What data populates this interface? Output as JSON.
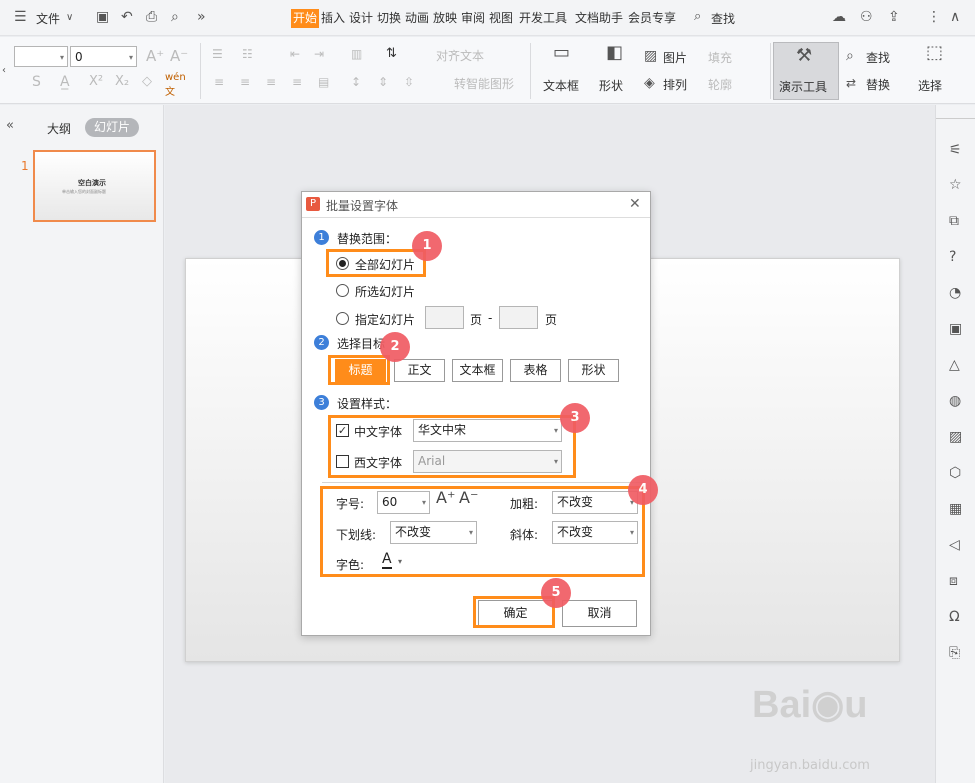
{
  "menubar": {
    "file_label": "文件",
    "tabs": [
      "开始",
      "插入",
      "设计",
      "切换",
      "动画",
      "放映",
      "审阅",
      "视图",
      "开发工具",
      "文档助手",
      "会员专享"
    ],
    "search_label": "查找"
  },
  "ribbon": {
    "font_size_value": "0",
    "align_text": "对齐文本",
    "smart_shape": "转智能图形",
    "textbox_label": "文本框",
    "shape_label": "形状",
    "picture_label": "图片",
    "arrange_label": "排列",
    "fill_label": "填充",
    "outline_label": "轮廓",
    "present_tool_label": "演示工具",
    "find_label": "查找",
    "replace_label": "替换",
    "select_label": "选择"
  },
  "leftpanel": {
    "outline_tab": "大纲",
    "slides_tab": "幻灯片",
    "slide_number": "1",
    "thumb_title": "空白演示",
    "thumb_subtitle": "单击输入您的封面副标题"
  },
  "dialog": {
    "title": "批量设置字体",
    "section1": "替换范围：",
    "radio_all": "全部幻灯片",
    "radio_selected": "所选幻灯片",
    "radio_specified": "指定幻灯片",
    "page_label": "页",
    "dash": "-",
    "page_label2": "页",
    "section2": "选择目标",
    "targets": [
      "标题",
      "正文",
      "文本框",
      "表格",
      "形状"
    ],
    "section3": "设置样式：",
    "cn_font_label": "中文字体",
    "cn_font_value": "华文中宋",
    "en_font_label": "西文字体",
    "en_font_value": "Arial",
    "size_label": "字号:",
    "size_value": "60",
    "bold_label": "加粗:",
    "bold_value": "不改变",
    "underline_label": "下划线:",
    "underline_value": "不改变",
    "italic_label": "斜体:",
    "italic_value": "不改变",
    "color_label": "字色:",
    "color_glyph": "A",
    "ok": "确定",
    "cancel": "取消",
    "section_nums": [
      "1",
      "2",
      "3"
    ]
  },
  "badges": [
    "1",
    "2",
    "3",
    "4",
    "5"
  ],
  "watermark": "jingyan.baidu.com",
  "colors": {
    "accent": "#ff8c1a",
    "badge": "#f05c63",
    "step": "#3d7fd9"
  }
}
